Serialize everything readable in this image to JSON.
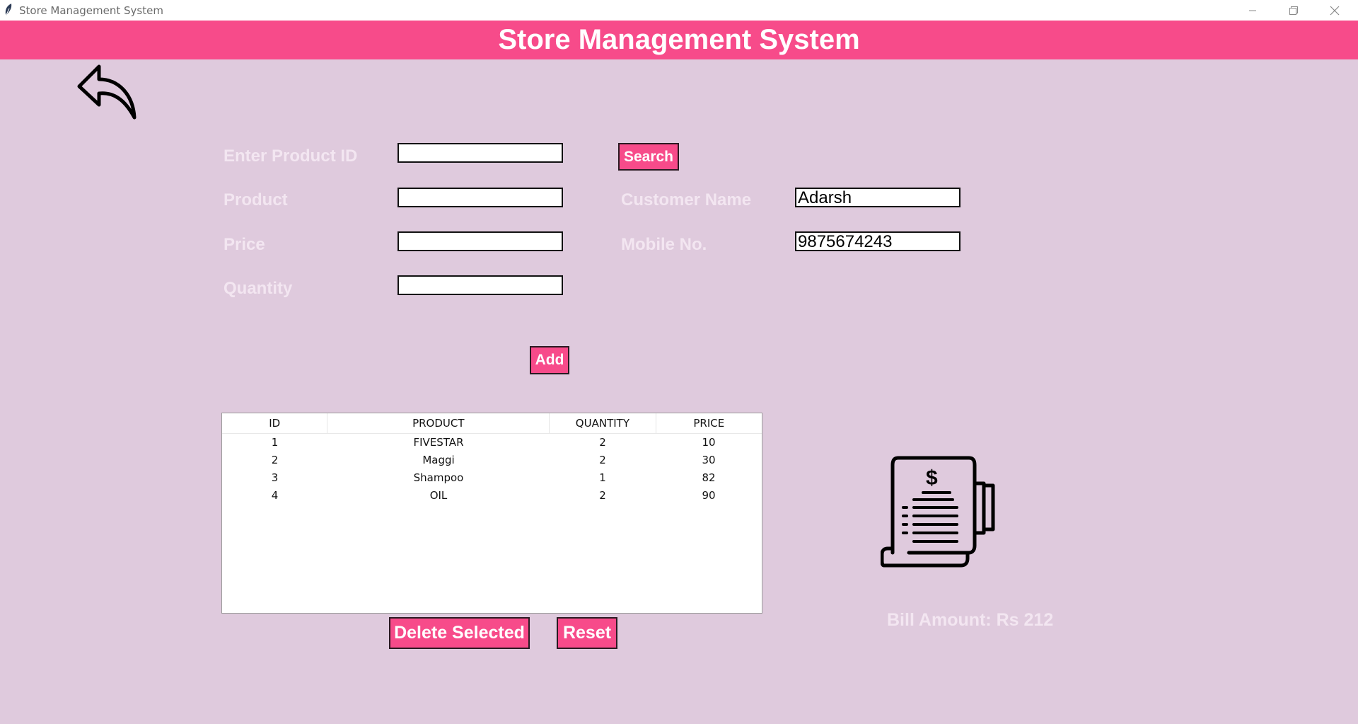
{
  "window": {
    "title": "Store Management System"
  },
  "header": {
    "title": "Store Management System"
  },
  "form": {
    "product_id_label": "Enter Product ID",
    "product_id_value": "",
    "product_label": "Product",
    "product_value": "",
    "price_label": "Price",
    "price_value": "",
    "quantity_label": "Quantity",
    "quantity_value": "",
    "search_label": "Search",
    "add_label": "Add",
    "customer_name_label": "Customer Name",
    "customer_name_value": "Adarsh",
    "mobile_label": "Mobile No.",
    "mobile_value": "9875674243"
  },
  "table": {
    "columns": [
      "ID",
      "PRODUCT",
      "QUANTITY",
      "PRICE"
    ],
    "rows": [
      [
        "1",
        "FIVESTAR",
        "2",
        "10"
      ],
      [
        "2",
        "Maggi",
        "2",
        "30"
      ],
      [
        "3",
        "Shampoo",
        "1",
        "82"
      ],
      [
        "4",
        "OIL",
        "2",
        "90"
      ]
    ]
  },
  "actions": {
    "delete_label": "Delete Selected",
    "reset_label": "Reset"
  },
  "bill": {
    "amount_text": "Bill Amount: Rs 212"
  },
  "icons": {
    "app": "feather-icon",
    "back": "back-arrow-icon",
    "bill": "receipt-dollar-icon",
    "minimize": "minimize-icon",
    "maximize": "restore-icon",
    "close": "close-icon"
  },
  "colors": {
    "accent": "#f74b8a",
    "background": "#dfcadd",
    "label": "#f3e6f1"
  }
}
